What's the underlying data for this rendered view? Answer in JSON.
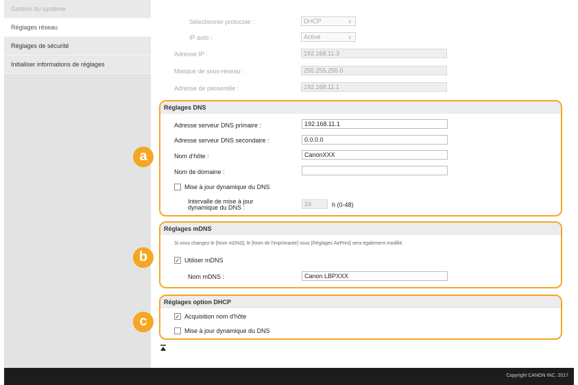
{
  "sidebar": {
    "items": [
      {
        "label": "Gestion du système",
        "state": "dim"
      },
      {
        "label": "Réglages réseau",
        "state": "active"
      },
      {
        "label": "Réglages de sécurité",
        "state": "normal"
      },
      {
        "label": "Initialiser informations de réglages",
        "state": "normal"
      }
    ]
  },
  "ip_section": {
    "protocol_label": "Sélectionner protocole :",
    "protocol_value": "DHCP",
    "auto_ip_label": "IP auto :",
    "auto_ip_value": "Activé",
    "ip_label": "Adresse IP :",
    "ip_value": "192.168.11.3",
    "mask_label": "Masque de sous-réseau :",
    "mask_value": "255.255.255.0",
    "gateway_label": "Adresse de passerelle :",
    "gateway_value": "192.168.11.1"
  },
  "dns": {
    "title": "Réglages DNS",
    "callout": "a",
    "primary_label": "Adresse serveur DNS primaire :",
    "primary_value": "192.168.11.1",
    "secondary_label": "Adresse serveur DNS secondaire :",
    "secondary_value": "0.0.0.0",
    "hostname_label": "Nom d'hôte :",
    "hostname_value": "CanonXXX",
    "domain_label": "Nom de domaine :",
    "domain_value": "",
    "dyn_update_label": "Mise à jour dynamique du DNS",
    "dyn_update_checked": false,
    "interval_label_1": "Intervalle de mise à jour",
    "interval_label_2": "dynamique du DNS :",
    "interval_value": "24",
    "interval_unit": "h (0-48)"
  },
  "mdns": {
    "title": "Réglages mDNS",
    "callout": "b",
    "note": "Si vous changez le [Nom mDNS], le [Nom de l'imprimante] sous [Réglages AirPrint] sera également modifié.",
    "use_label": "Utiliser mDNS",
    "use_checked": true,
    "name_label": "Nom mDNS :",
    "name_value": "Canon LBPXXX"
  },
  "dhcp": {
    "title": "Réglages option DHCP",
    "callout": "c",
    "hostname_acq_label": "Acquisition nom d'hôte",
    "hostname_acq_checked": true,
    "dyn_update_label": "Mise à jour dynamique du DNS",
    "dyn_update_checked": false
  },
  "footer": {
    "copyright": "Copyright CANON INC. 2017"
  },
  "colors": {
    "accent": "#f5a623",
    "footer_bg": "#1c1c1c",
    "sidebar_bg": "#e3e3e3"
  }
}
